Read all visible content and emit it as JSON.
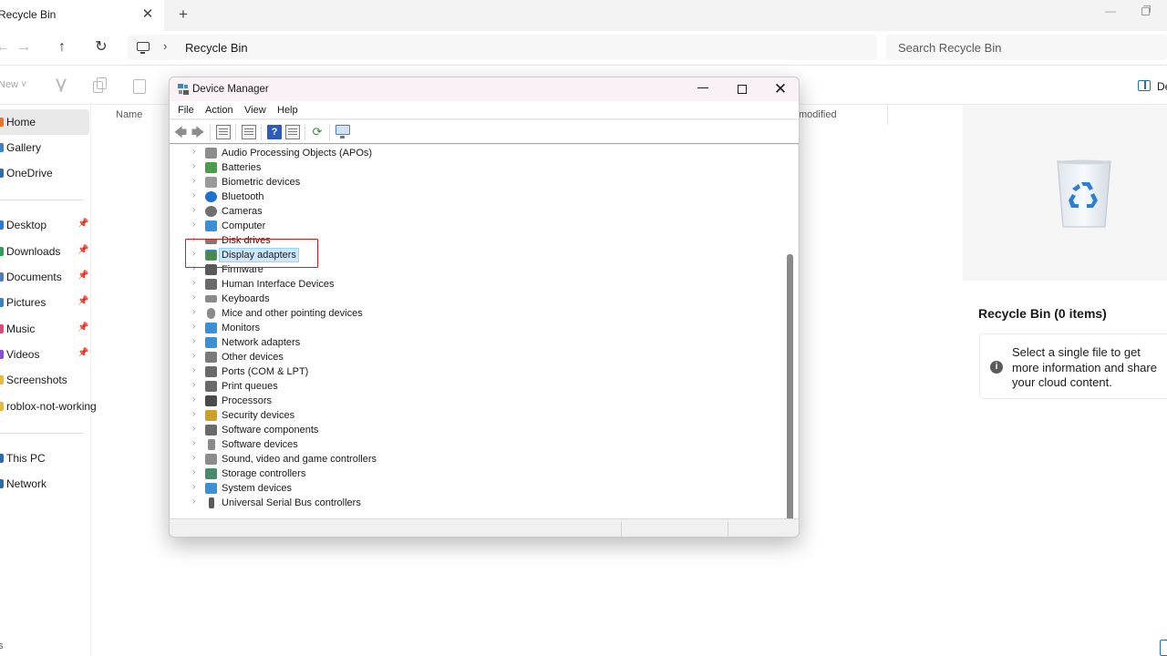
{
  "explorer": {
    "tab": {
      "title": "Recycle Bin",
      "close_glyph": "✕",
      "new_glyph": "+"
    },
    "window_controls": {
      "minimize_glyph": "—"
    },
    "nav": {
      "back_glyph": "←",
      "forward_glyph": "→",
      "up_glyph": "↑",
      "refresh_glyph": "↻"
    },
    "address": {
      "separator": "›",
      "path": "Recycle Bin"
    },
    "search": {
      "placeholder": "Search Recycle Bin"
    },
    "toolbar": {
      "new_label": "New ˅",
      "details_label": "De"
    },
    "sidebar": {
      "items": [
        {
          "label": "Home",
          "color": "#e8742a",
          "pinned": false,
          "selected": true
        },
        {
          "label": "Gallery",
          "color": "#3b82c4",
          "pinned": false
        },
        {
          "label": "OneDrive",
          "color": "#2b6cb0",
          "pinned": false
        },
        {
          "label": "Desktop",
          "color": "#2b7bd6",
          "pinned": true
        },
        {
          "label": "Downloads",
          "color": "#2e9e5b",
          "pinned": true
        },
        {
          "label": "Documents",
          "color": "#4a7fbf",
          "pinned": true
        },
        {
          "label": "Pictures",
          "color": "#3b82c4",
          "pinned": true
        },
        {
          "label": "Music",
          "color": "#e0457b",
          "pinned": true
        },
        {
          "label": "Videos",
          "color": "#8a4fd6",
          "pinned": true
        },
        {
          "label": "Screenshots",
          "color": "#e8b93a",
          "pinned": false
        },
        {
          "label": "roblox-not-working",
          "color": "#e8b93a",
          "pinned": false
        },
        {
          "label": "This PC",
          "color": "#2b6cb0",
          "pinned": false
        },
        {
          "label": "Network",
          "color": "#2b6cb0",
          "pinned": false
        }
      ],
      "pin_glyph": "📌",
      "bottom_text": "s"
    },
    "columns": {
      "name": "Name",
      "modified": "modified"
    },
    "preview": {
      "title": "Recycle Bin (0 items)",
      "info_glyph": "i",
      "info_text": "Select a single file to get more information and share your cloud content."
    }
  },
  "device_manager": {
    "title": "Device Manager",
    "close_glyph": "✕",
    "menu": [
      "File",
      "Action",
      "View",
      "Help"
    ],
    "toolbar": {
      "back_glyph": "🡄",
      "forward_glyph": "🡆",
      "help_glyph": "?",
      "scan_glyph": "⟳"
    },
    "expand_glyph": "›",
    "tree": [
      {
        "label": "Audio Processing Objects (APOs)",
        "icon": "speaker-icon",
        "color": "#8c8c8c"
      },
      {
        "label": "Batteries",
        "icon": "battery-icon",
        "color": "#4a9d4a"
      },
      {
        "label": "Biometric devices",
        "icon": "fingerprint-icon",
        "color": "#9a9a9a"
      },
      {
        "label": "Bluetooth",
        "icon": "bluetooth-icon",
        "color": "#1f6fd1"
      },
      {
        "label": "Cameras",
        "icon": "camera-icon",
        "color": "#6f6f6f"
      },
      {
        "label": "Computer",
        "icon": "computer-icon",
        "color": "#3a8fd6"
      },
      {
        "label": "Disk drives",
        "icon": "disk-drive-icon",
        "color": "#7a7a7a"
      },
      {
        "label": "Display adapters",
        "icon": "display-adapter-icon",
        "color": "#4a8a4a",
        "selected": true
      },
      {
        "label": "Firmware",
        "icon": "firmware-icon",
        "color": "#5a5a5a"
      },
      {
        "label": "Human Interface Devices",
        "icon": "hid-icon",
        "color": "#6a6a6a"
      },
      {
        "label": "Keyboards",
        "icon": "keyboard-icon",
        "color": "#8a8a8a"
      },
      {
        "label": "Mice and other pointing devices",
        "icon": "mouse-icon",
        "color": "#8a8a8a"
      },
      {
        "label": "Monitors",
        "icon": "monitor-icon",
        "color": "#3a8fd6"
      },
      {
        "label": "Network adapters",
        "icon": "network-adapter-icon",
        "color": "#3a8fd6"
      },
      {
        "label": "Other devices",
        "icon": "other-devices-icon",
        "color": "#7a7a7a"
      },
      {
        "label": "Ports (COM & LPT)",
        "icon": "port-icon",
        "color": "#6a6a6a"
      },
      {
        "label": "Print queues",
        "icon": "printer-icon",
        "color": "#6a6a6a"
      },
      {
        "label": "Processors",
        "icon": "processor-icon",
        "color": "#4a4a4a"
      },
      {
        "label": "Security devices",
        "icon": "security-device-icon",
        "color": "#c9a227"
      },
      {
        "label": "Software components",
        "icon": "software-component-icon",
        "color": "#6a6a6a"
      },
      {
        "label": "Software devices",
        "icon": "software-device-icon",
        "color": "#8a8a8a"
      },
      {
        "label": "Sound, video and game controllers",
        "icon": "sound-icon",
        "color": "#8c8c8c"
      },
      {
        "label": "Storage controllers",
        "icon": "storage-controller-icon",
        "color": "#4a8a6a"
      },
      {
        "label": "System devices",
        "icon": "system-device-icon",
        "color": "#3a8fd6"
      },
      {
        "label": "Universal Serial Bus controllers",
        "icon": "usb-icon",
        "color": "#5a5a5a"
      }
    ],
    "highlight_color": "#d81b1b"
  }
}
